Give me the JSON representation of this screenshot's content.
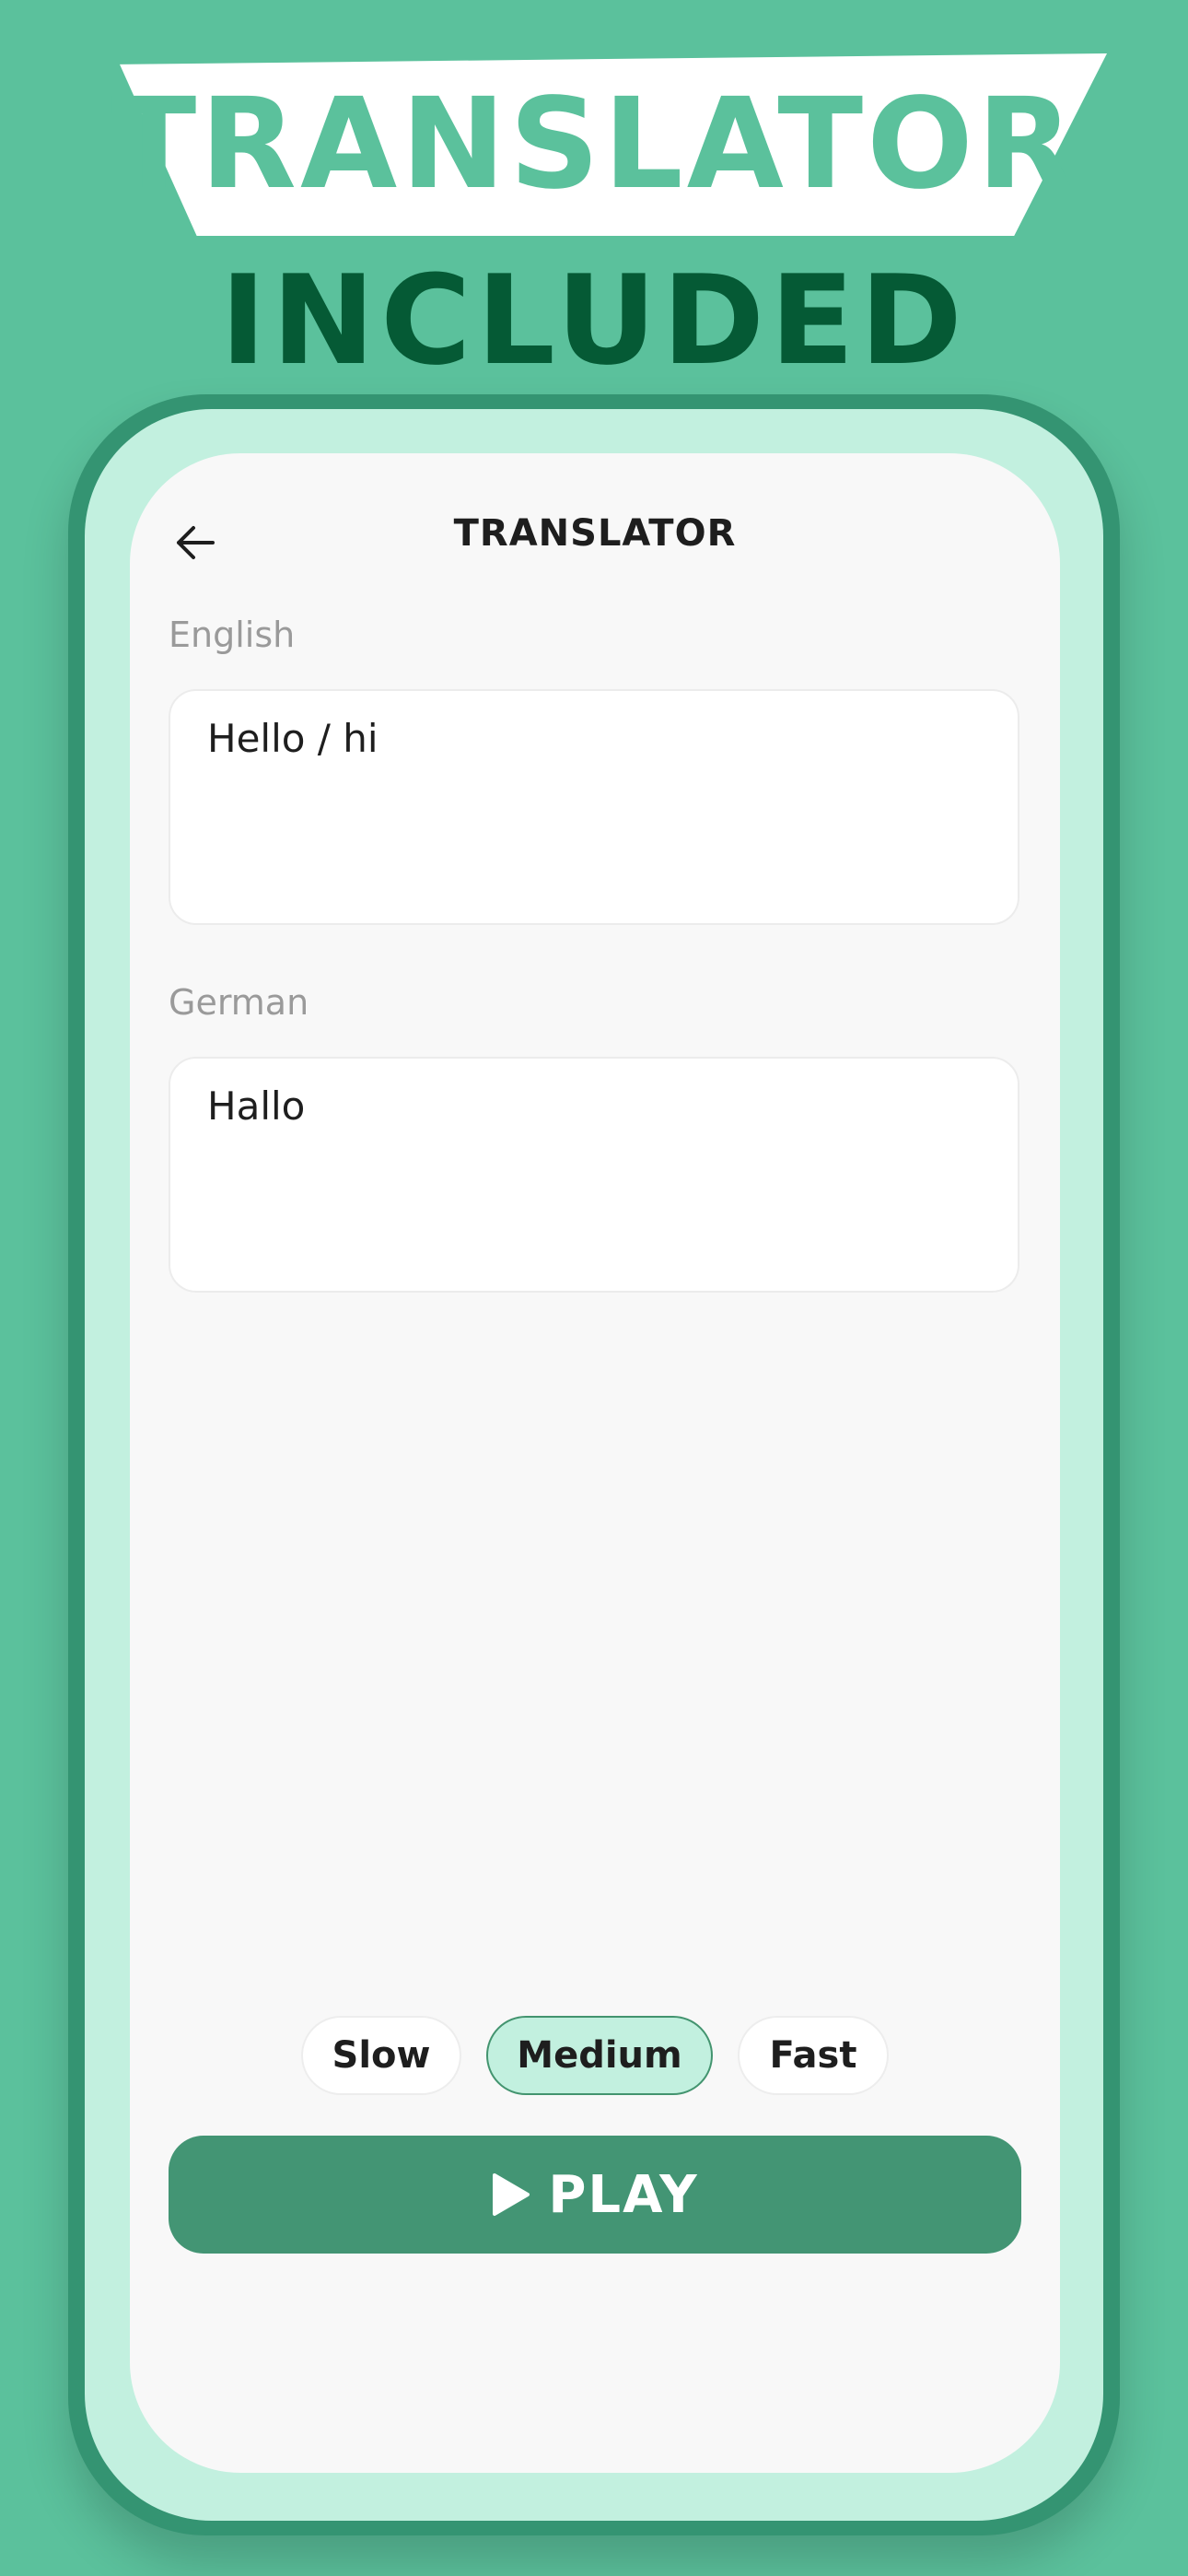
{
  "header": {
    "banner_title": "TRANSLATOR",
    "subtitle": "INCLUDED"
  },
  "screen": {
    "title": "TRANSLATOR",
    "back_icon": "arrow-left-icon",
    "source": {
      "label": "English",
      "text": "Hello / hi"
    },
    "target": {
      "label": "German",
      "text": "Hallo"
    },
    "speeds": {
      "options": [
        "Slow",
        "Medium",
        "Fast"
      ],
      "selected": "Medium"
    },
    "play": {
      "label": "PLAY",
      "icon": "play-icon"
    }
  },
  "colors": {
    "background": "#5bc19c",
    "subtitle": "#055a35",
    "accent": "#439574",
    "selected_pill": "#c2f0df"
  }
}
